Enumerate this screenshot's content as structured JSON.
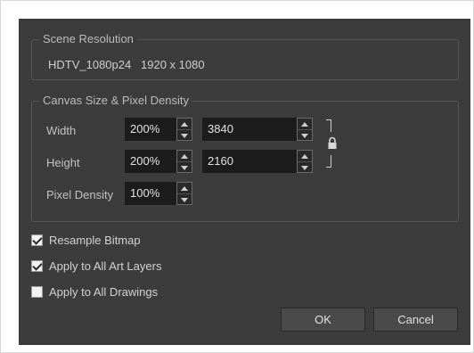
{
  "scene_resolution": {
    "title": "Scene Resolution",
    "preset": "HDTV_1080p24",
    "dimensions": "1920 x 1080"
  },
  "canvas": {
    "title": "Canvas Size & Pixel Density",
    "width_label": "Width",
    "width_percent": "200%",
    "width_value": "3840",
    "height_label": "Height",
    "height_percent": "200%",
    "height_value": "2160",
    "density_label": "Pixel Density",
    "density_percent": "100%",
    "aspect_locked": true
  },
  "options": [
    {
      "label": "Resample Bitmap",
      "checked": true
    },
    {
      "label": "Apply to All Art Layers",
      "checked": true
    },
    {
      "label": "Apply to All Drawings",
      "checked": false
    }
  ],
  "buttons": {
    "ok": "OK",
    "cancel": "Cancel"
  },
  "colors": {
    "dialog_bg": "#3c3c3c",
    "field_bg": "#1c1c1c",
    "text": "#c2c2c2"
  },
  "icons": {
    "spin": "up-down-arrow-icon",
    "lock": "lock-icon",
    "check": "checkmark-icon"
  }
}
